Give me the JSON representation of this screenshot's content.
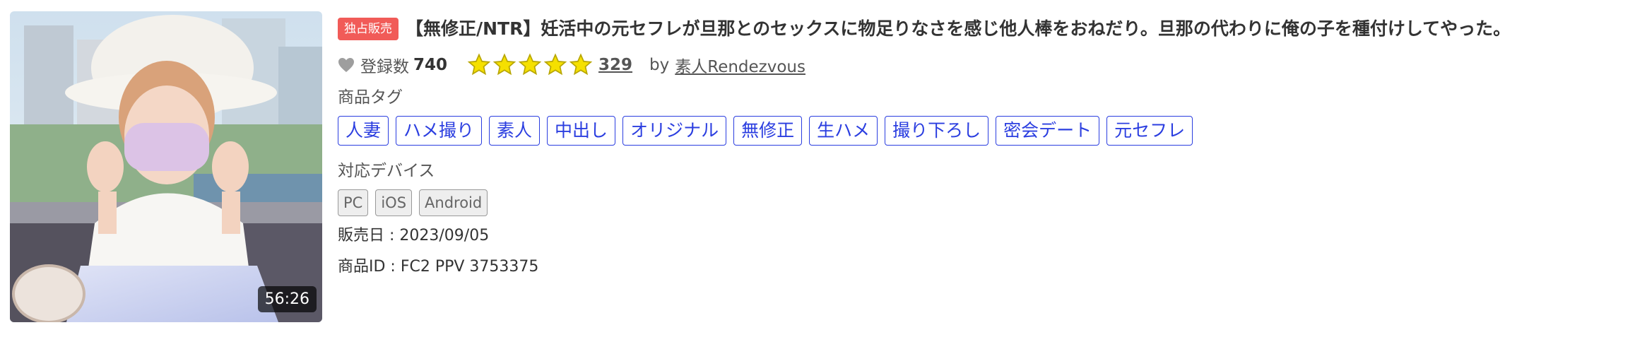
{
  "thumbnail": {
    "duration": "56:26"
  },
  "title": {
    "badge": "独占販売",
    "text": "【無修正/NTR】妊活中の元セフレが旦那とのセックスに物足りなさを感じ他人棒をおねだり。旦那の代わりに俺の子を種付けしてやった。"
  },
  "meta": {
    "favorite_label": "登録数",
    "favorite_count": "740",
    "rating_stars": 5,
    "review_count": "329",
    "by_label": "by",
    "seller": "素人Rendezvous"
  },
  "tags": {
    "label": "商品タグ",
    "items": [
      "人妻",
      "ハメ撮り",
      "素人",
      "中出し",
      "オリジナル",
      "無修正",
      "生ハメ",
      "撮り下ろし",
      "密会デート",
      "元セフレ"
    ]
  },
  "devices": {
    "label": "対応デバイス",
    "items": [
      "PC",
      "iOS",
      "Android"
    ]
  },
  "details": {
    "release_date": "販売日 : 2023/09/05",
    "product_id": "商品ID : FC2 PPV 3753375"
  },
  "colors": {
    "badge": "#f15b58",
    "tag": "#2b3ee0",
    "star": "#f5e000",
    "star_outline": "#b8a600"
  },
  "icons": {
    "favorite": "heart-icon",
    "rating": "star-icon"
  }
}
